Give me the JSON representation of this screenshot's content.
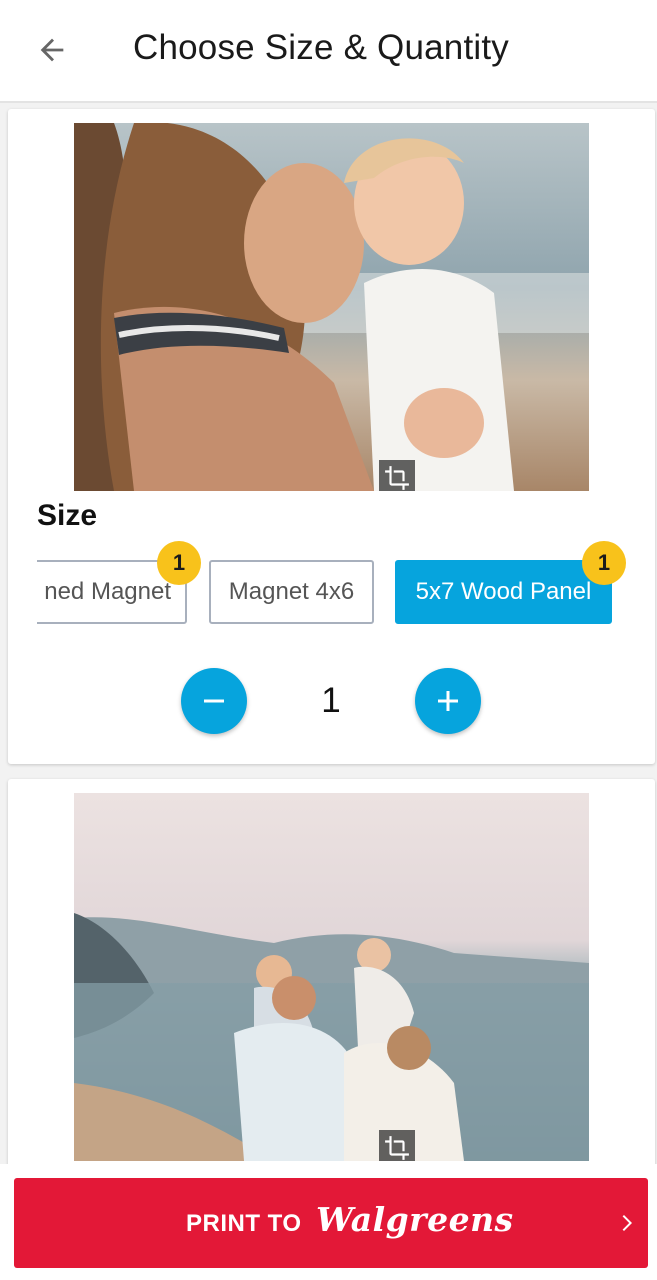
{
  "header": {
    "title": "Choose Size & Quantity",
    "back_icon": "arrow-back-icon"
  },
  "cards": [
    {
      "photo_description_icon": "crop-icon",
      "size_label": "Size",
      "sizes": [
        {
          "label": "Framed Magnet",
          "visible_text": "ned Magnet",
          "badge": "1",
          "selected": false
        },
        {
          "label": "Magnet 4x6",
          "badge": null,
          "selected": false
        },
        {
          "label": "5x7 Wood Panel",
          "badge": "1",
          "selected": true
        }
      ],
      "quantity": "1",
      "minus_icon": "minus-icon",
      "plus_icon": "plus-icon"
    },
    {
      "photo_description_icon": "crop-icon"
    }
  ],
  "footer": {
    "print_label": "PRINT TO",
    "brand": "Walgreens",
    "chevron_icon": "chevron-right-icon"
  },
  "colors": {
    "accent_blue": "#06a4dd",
    "badge_yellow": "#f8c21b",
    "print_red": "#e31837"
  }
}
